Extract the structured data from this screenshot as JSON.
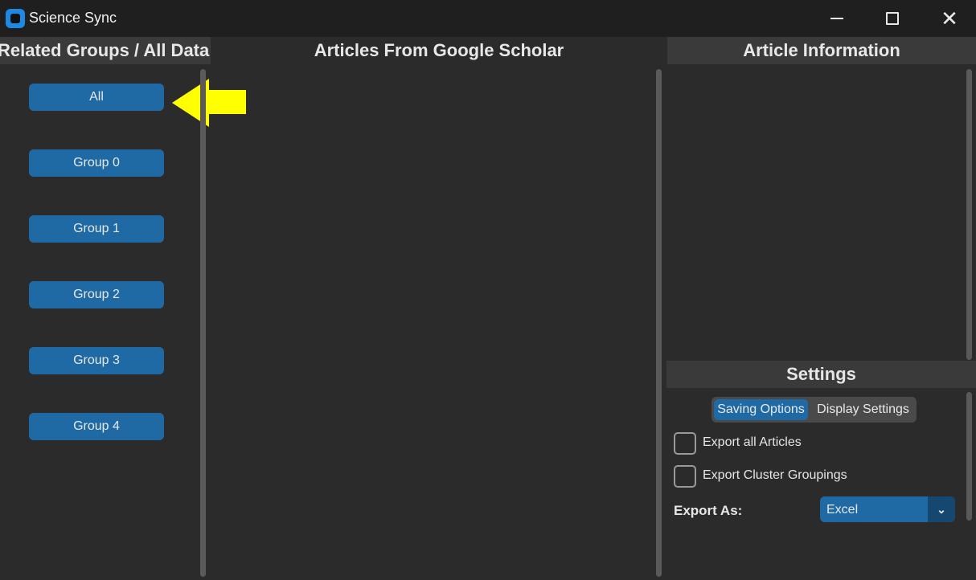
{
  "window": {
    "title": "Science Sync",
    "minimize_icon": "minimize-icon",
    "maximize_icon": "maximize-icon",
    "close_icon": "close-icon",
    "close_glyph": "✕"
  },
  "headers": {
    "groups": "Related Groups / All Data",
    "articles": "Articles From Google Scholar",
    "info": "Article Information"
  },
  "groups": {
    "items": [
      {
        "label": "All"
      },
      {
        "label": "Group 0"
      },
      {
        "label": "Group 1"
      },
      {
        "label": "Group 2"
      },
      {
        "label": "Group 3"
      },
      {
        "label": "Group 4"
      }
    ]
  },
  "annotation": {
    "arrow_color": "#ffff00",
    "icon": "arrow-left-icon"
  },
  "settings": {
    "title": "Settings",
    "tabs": [
      {
        "label": "Saving Options",
        "selected": true
      },
      {
        "label": "Display Settings",
        "selected": false
      }
    ],
    "export_all_label": "Export all Articles",
    "export_cluster_label": "Export Cluster Groupings",
    "export_as_label": "Export As:",
    "export_as_value": "Excel",
    "dropdown_icon": "chevron-down-icon"
  },
  "colors": {
    "accent": "#1f6aa5",
    "background": "#2b2b2b",
    "header": "#3a3a3a",
    "titlebar": "#1f1f1f"
  }
}
